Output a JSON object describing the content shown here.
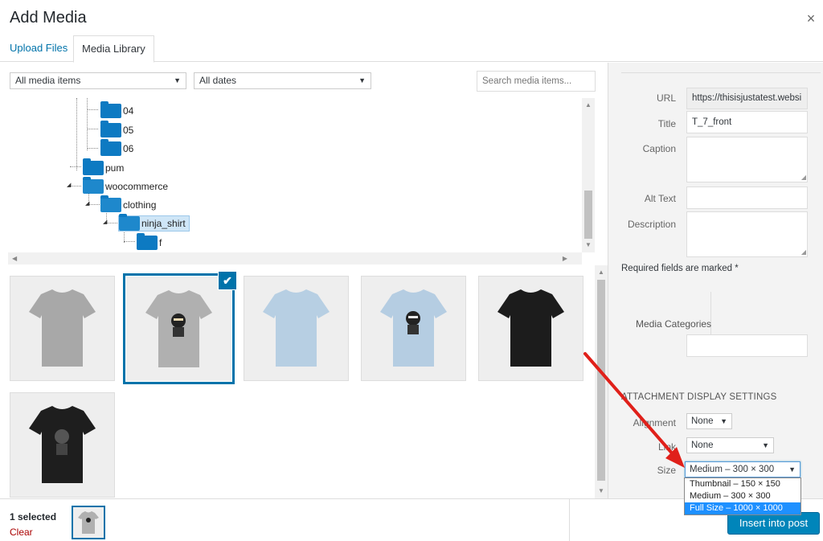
{
  "modal": {
    "title": "Add Media",
    "close_glyph": "×"
  },
  "tabs": [
    {
      "label": "Upload Files"
    },
    {
      "label": "Media Library"
    }
  ],
  "filters": {
    "media_type": "All media items",
    "dates": "All dates",
    "search_placeholder": "Search media items..."
  },
  "tree": {
    "nodes": [
      "04",
      "05",
      "06",
      "pum",
      "woocommerce",
      "clothing",
      "ninja_shirt",
      "f"
    ],
    "selected": "ninja_shirt"
  },
  "grid": {
    "items": [
      {
        "name": "grey t-shirt",
        "color": "#a8a8a8",
        "logo": false
      },
      {
        "name": "grey t-shirt ninja",
        "color": "#b0b0b0",
        "logo": true,
        "selected": true
      },
      {
        "name": "blue t-shirt",
        "color": "#b7cfe3",
        "logo": false
      },
      {
        "name": "blue t-shirt ninja",
        "color": "#b5cde2",
        "logo": true
      },
      {
        "name": "black t-shirt",
        "color": "#1c1c1c",
        "logo": false
      },
      {
        "name": "black t-shirt ninja",
        "color": "#1e1e1e",
        "logo": true
      }
    ]
  },
  "details": {
    "url_label": "URL",
    "url_value": "https://thisisjustatest.websi",
    "title_label": "Title",
    "title_value": "T_7_front",
    "caption_label": "Caption",
    "alt_label": "Alt Text",
    "description_label": "Description",
    "required_note": "Required fields are marked *",
    "media_categories_label": "Media Categories"
  },
  "display_settings": {
    "heading": "ATTACHMENT DISPLAY SETTINGS",
    "alignment_label": "Alignment",
    "alignment_value": "None",
    "link_label": "Link",
    "link_value": "None",
    "size_label": "Size",
    "size_value": "Medium – 300 × 300",
    "size_options": [
      "Thumbnail – 150 × 150",
      "Medium – 300 × 300",
      "Full Size – 1000 × 1000"
    ],
    "highlighted_option": "Full Size – 1000 × 1000"
  },
  "footer": {
    "selected_count": "1 selected",
    "clear_label": "Clear",
    "insert_label": "Insert into post"
  },
  "colors": {
    "accent": "#0073aa",
    "button": "#0085ba",
    "folder": "#0d7ac2",
    "arrow": "#e0201a",
    "dropdown_highlight": "#1e90ff"
  }
}
